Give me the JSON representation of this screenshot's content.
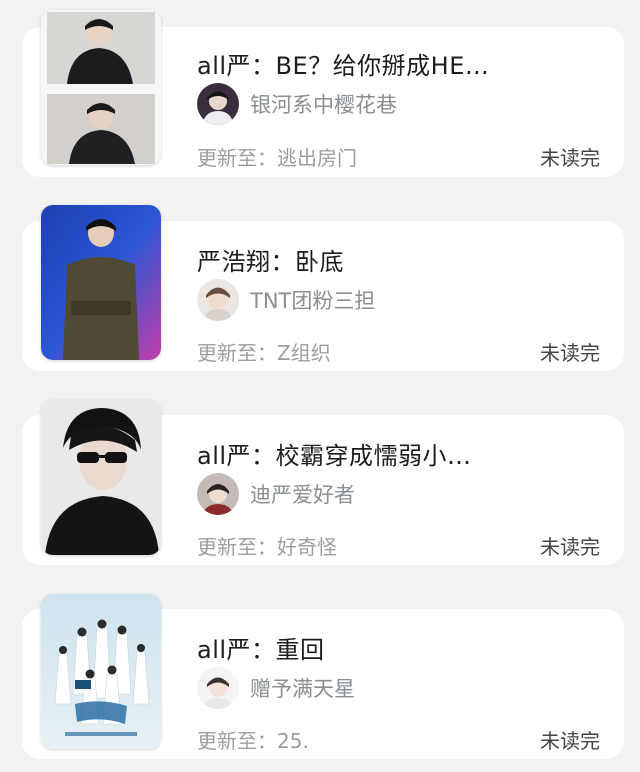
{
  "items": [
    {
      "title": "all严：BE？给你掰成HE…",
      "author": "银河系中樱花巷",
      "update": "更新至：逃出房门",
      "status": "未读完",
      "cover_icon": "cover-image",
      "avatar_icon": "avatar-image"
    },
    {
      "title": "严浩翔：卧底",
      "author": "TNT团粉三担",
      "update": "更新至：Z组织",
      "status": "未读完",
      "cover_icon": "cover-image",
      "avatar_icon": "avatar-image"
    },
    {
      "title": "all严：校霸穿成懦弱小…",
      "author": "迪严爱好者",
      "update": "更新至：好奇怪",
      "status": "未读完",
      "cover_icon": "cover-image",
      "avatar_icon": "avatar-image"
    },
    {
      "title": "all严：重回",
      "author": "赠予满天星",
      "update": "更新至：25.",
      "status": "未读完",
      "cover_icon": "cover-image",
      "avatar_icon": "avatar-image"
    }
  ]
}
